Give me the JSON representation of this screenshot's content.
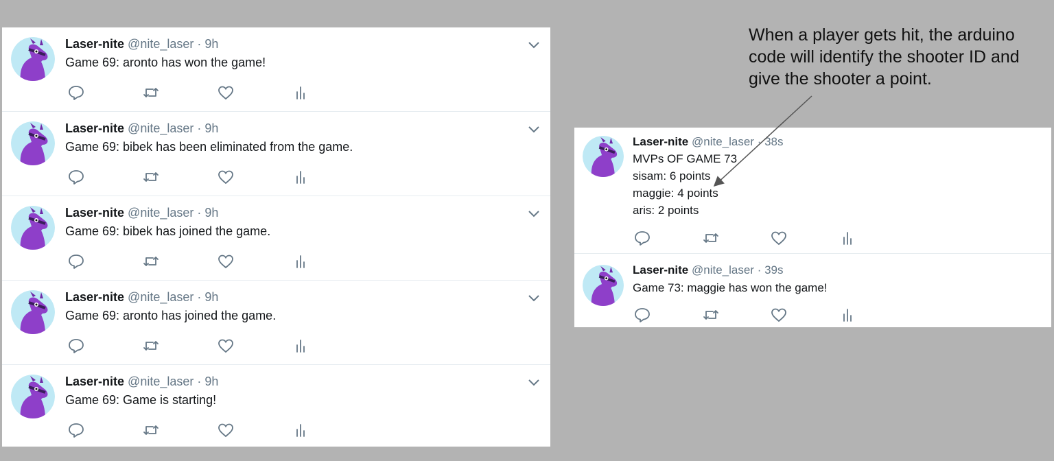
{
  "left_feed": {
    "tweets": [
      {
        "name": "Laser-nite",
        "handle": "@nite_laser",
        "dot": "·",
        "time": "9h",
        "text": "Game 69: aronto has won the game!"
      },
      {
        "name": "Laser-nite",
        "handle": "@nite_laser",
        "dot": "·",
        "time": "9h",
        "text": "Game 69: bibek has been eliminated from the game."
      },
      {
        "name": "Laser-nite",
        "handle": "@nite_laser",
        "dot": "·",
        "time": "9h",
        "text": "Game 69: bibek has joined the game."
      },
      {
        "name": "Laser-nite",
        "handle": "@nite_laser",
        "dot": "·",
        "time": "9h",
        "text": "Game 69: aronto has joined the game."
      },
      {
        "name": "Laser-nite",
        "handle": "@nite_laser",
        "dot": "·",
        "time": "9h",
        "text": "Game 69: Game is starting!"
      }
    ]
  },
  "right_feed": {
    "tweets": [
      {
        "name": "Laser-nite",
        "handle": "@nite_laser",
        "dot": "·",
        "time": "38s",
        "lines": [
          "MVPs OF GAME 73",
          "sisam: 6 points",
          "maggie: 4 points",
          "aris: 2 points"
        ]
      },
      {
        "name": "Laser-nite",
        "handle": "@nite_laser",
        "dot": "·",
        "time": "39s",
        "lines": [
          "Game 73: maggie has won the game!"
        ]
      }
    ]
  },
  "annotation": {
    "text": "When a player gets hit, the arduino code will identify the shooter ID and give the shooter a point."
  },
  "icons": {
    "avatar": "purple-llama-avatar-icon",
    "reply": "reply-icon",
    "retweet": "retweet-icon",
    "like": "heart-icon",
    "analytics": "analytics-icon",
    "menu": "chevron-down-icon"
  },
  "colors": {
    "background": "#b3b3b3",
    "card": "#ffffff",
    "text": "#14171a",
    "secondary": "#657786",
    "avatar_purple": "#8e3fc9",
    "avatar_bg": "#bfe9f5"
  }
}
